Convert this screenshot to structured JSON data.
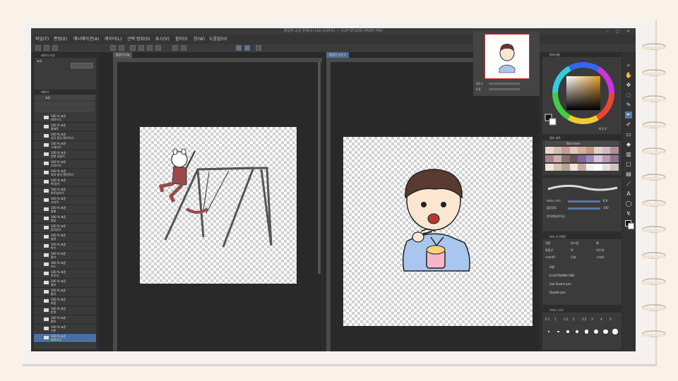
{
  "window": {
    "title": "졸업작 소년 문제(1).clip (100%) — CLIP STUDIO PAINT PRO",
    "controls": "– ▢ ✕"
  },
  "menu": [
    "파일(F)",
    "편집(E)",
    "애니메이션(A)",
    "레이어(L)",
    "선택 범위(S)",
    "표시(V)",
    "필터(I)",
    "창(W)",
    "도움말(H)"
  ],
  "left_panel": {
    "header_top": "레이어 속성",
    "effect_label": "효과",
    "header_layers": "레이어",
    "blend_mode": "표준",
    "layers": [
      {
        "pct": "100 % 표준",
        "name": "레이어 1"
      },
      {
        "pct": "100 % 표준",
        "name": "팔레트"
      },
      {
        "pct": "100 % 표준",
        "name": "생각 풍선 들어가기"
      },
      {
        "pct": "100 % 표준",
        "name": "그네타기"
      },
      {
        "pct": "100 % 표준",
        "name": "양팔 흔들기"
      },
      {
        "pct": "100 % 표준",
        "name": "기다리기"
      },
      {
        "pct": "100 % 표준",
        "name": "과자 봉지 열어먹기"
      },
      {
        "pct": "100 % 표준",
        "name": "책 읽기"
      },
      {
        "pct": "100 % 표준",
        "name": "하트날리기"
      },
      {
        "pct": "100 % 표준",
        "name": "고양이"
      },
      {
        "pct": "100 % 표준",
        "name": "깜빡"
      },
      {
        "pct": "100 % 표준",
        "name": "회상"
      },
      {
        "pct": "100 % 표준",
        "name": "음악듣기"
      },
      {
        "pct": "100 % 표준",
        "name": "놀람"
      },
      {
        "pct": "100 % 표준",
        "name": "박수"
      },
      {
        "pct": "100 % 표준",
        "name": "울기"
      },
      {
        "pct": "100 % 표준",
        "name": "미소"
      },
      {
        "pct": "100 % 표준",
        "name": "손인사"
      },
      {
        "pct": "100 % 표준",
        "name": "윙크"
      },
      {
        "pct": "100 % 표준",
        "name": "졸기"
      },
      {
        "pct": "100 % 표준",
        "name": "하품"
      },
      {
        "pct": "100 % 표준",
        "name": "반짝"
      },
      {
        "pct": "100 % 표준",
        "name": "환호"
      },
      {
        "pct": "100 % 표준",
        "name": "기본"
      },
      {
        "pct": "100 % 표준",
        "name": "레이어 2"
      }
    ]
  },
  "docs": {
    "tab_left": "졸업작.clip",
    "tab_right": "졸업작 소년 1"
  },
  "navigator": {
    "zoom": "33.3",
    "rotate": "0.0"
  },
  "color_panel": {
    "header": "컬러서클",
    "hsv": "H S V"
  },
  "color_set": {
    "header": "컬러 세트",
    "set_name": "Skin tone"
  },
  "colors": {
    "swatches": [
      "#e9d6d2",
      "#d8b9b5",
      "#c89c98",
      "#e8c7b6",
      "#d7b1a0",
      "#c49887",
      "#e3d0c8",
      "#cdbcc0",
      "#b38e9c",
      "#a98190",
      "#cbb2a9",
      "#8b6f74",
      "#6c5257",
      "#7a6a9a",
      "#9a8bb8",
      "#d9c5d9",
      "#b79cb6",
      "#8e738c",
      "#f1e4dd",
      "#d4c3b5",
      "#b9a493",
      "#efe3e2",
      "#caa8a3",
      "#f5f0ec",
      "#ffffff",
      "#e5e0dc",
      "#cbc5c1"
    ]
  },
  "tool_property": {
    "brush_size_label": "브러시 크기",
    "brush_size_value": "6.0",
    "opacity_label": "불투명도",
    "opacity_value": "100",
    "stabilization_label": "안티에일리어싱"
  },
  "subtool": {
    "header": "보조 도구[펜]",
    "tabs": [
      "연필",
      "마스킹",
      "펜",
      "말풍선",
      "붓",
      "지우개",
      "스포이트",
      "도형",
      "그라데"
    ],
    "brushes": [
      "G펜",
      "ILLUSTDANIA PEN",
      "fool Sketch pen",
      "Doodle pen"
    ]
  },
  "brush_size_panel": {
    "header": "브러시 크기",
    "sizes": [
      "0.7",
      "1",
      "1.5",
      "2",
      "2.5",
      "3",
      "4",
      "5"
    ]
  }
}
